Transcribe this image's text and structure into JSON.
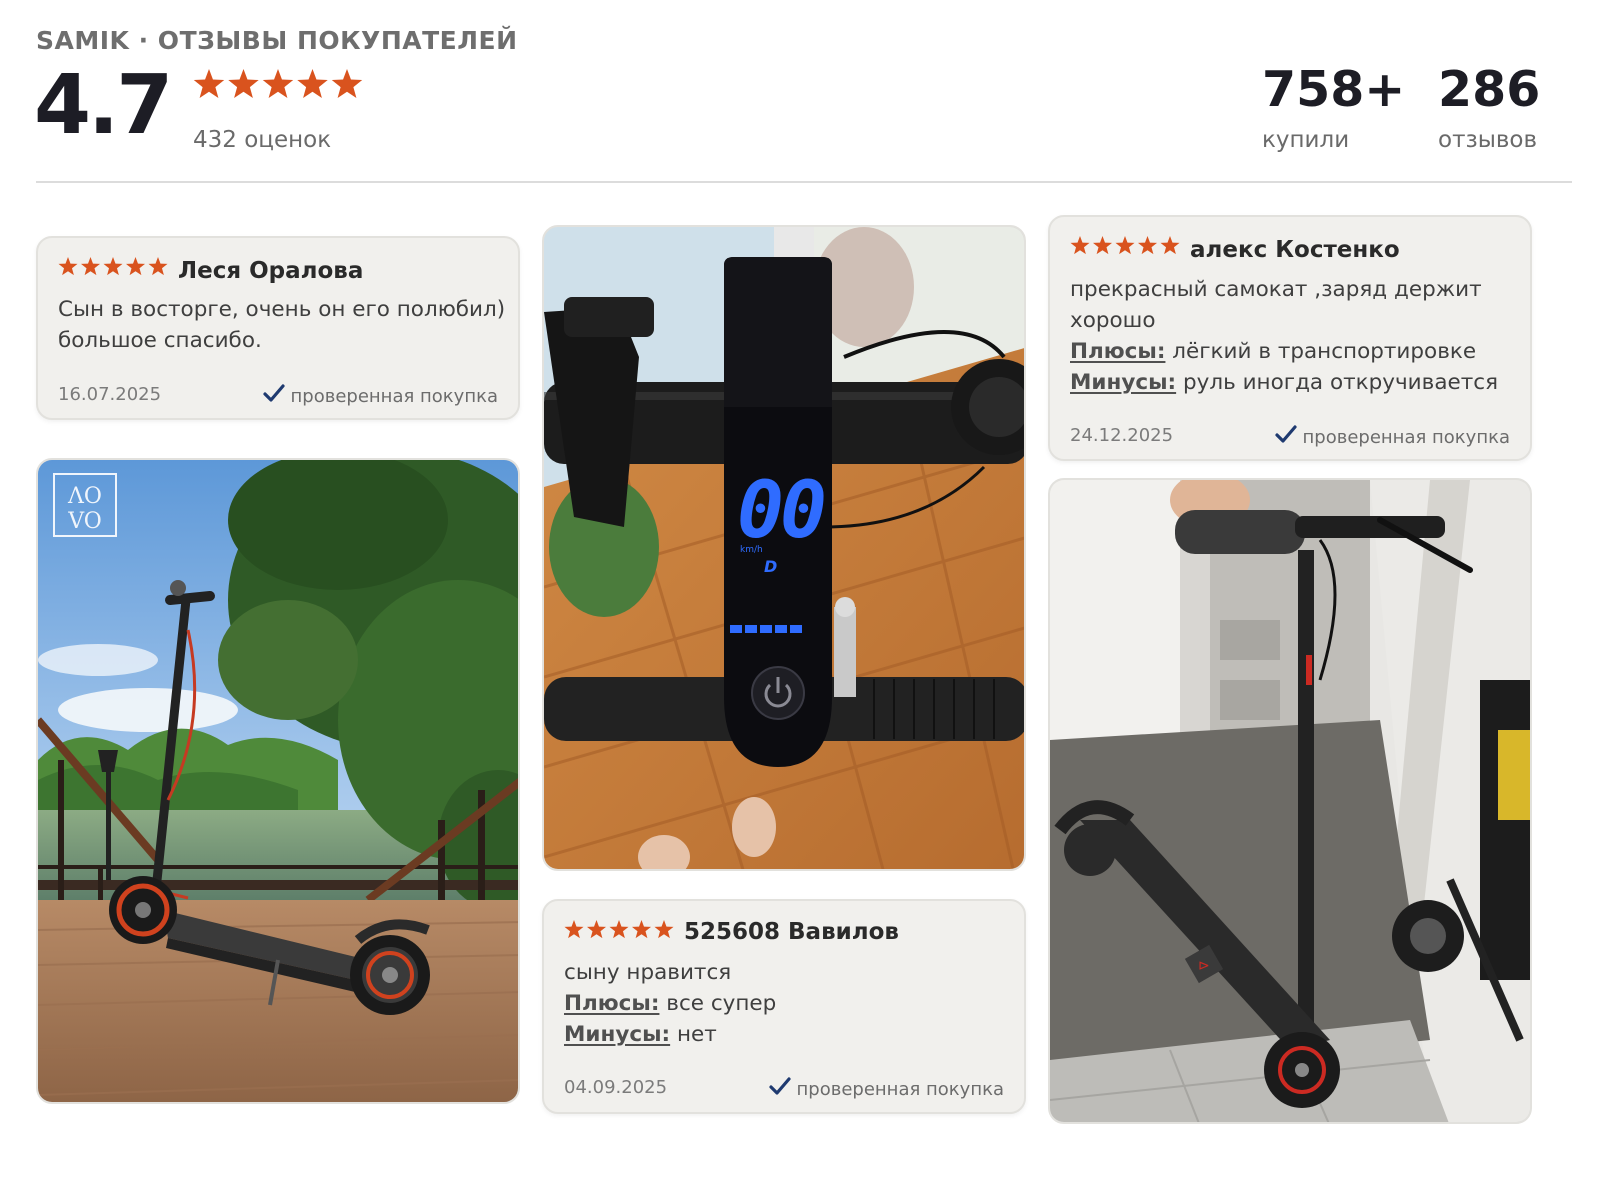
{
  "header": {
    "brand": "SAMIK · ОТЗЫВЫ ПОКУПАТЕЛЕЙ",
    "score": "4.7",
    "score_stars": 5,
    "ratings_count": "432 оценок",
    "bought_value": "758+",
    "bought_label": "купили",
    "reviews_value": "286",
    "reviews_label": "отзывов"
  },
  "colors": {
    "star": "#d9531e",
    "verified_check": "#1f3a70",
    "card_bg": "#f1f0ed"
  },
  "reviews": [
    {
      "rating": 5,
      "author": "Леся Оралова",
      "text_lines": [
        "Сын в восторге, очень он его полюбил)",
        "большое спасибо."
      ],
      "date": "16.07.2025",
      "verified": "проверенная покупка"
    },
    {
      "rating": 5,
      "author": "алекс Костенко",
      "text_lines": [
        "прекрасный самокат ,заряд держит",
        "хорошо"
      ],
      "pros_label": "Плюсы:",
      "pros": "лёгкий в транспортировке",
      "cons_label": "Минусы:",
      "cons": "руль иногда откручивается",
      "date": "24.12.2025",
      "verified": "проверенная покупка"
    },
    {
      "rating": 5,
      "author": "525608 Вавилов",
      "text_lines": [
        "сыну нравится"
      ],
      "pros_label": "Плюсы:",
      "pros": "все супер",
      "cons_label": "Минусы:",
      "cons": "нет",
      "date": "04.09.2025",
      "verified": "проверенная покупка"
    }
  ],
  "photos": {
    "display_speed": "00",
    "display_unit": "km/h",
    "display_gear": "D",
    "watermark_top": "ΛO",
    "watermark_bottom": "VO",
    "deck_badge": "⊳"
  }
}
